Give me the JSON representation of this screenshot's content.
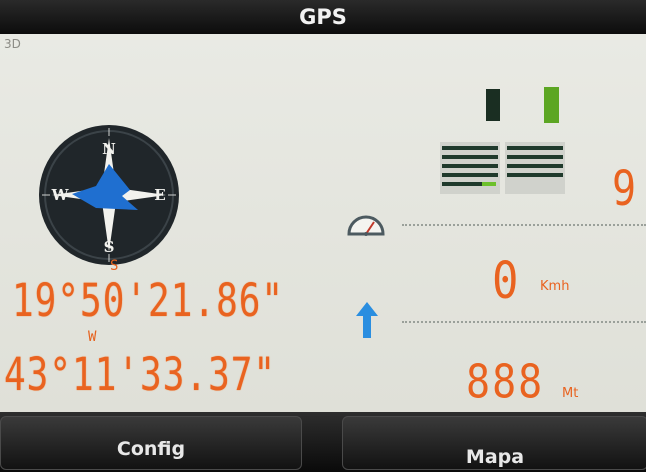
{
  "title": "GPS",
  "mode": "3D",
  "compass": {
    "n": "N",
    "s": "S",
    "e": "E",
    "w": "W"
  },
  "latitude": {
    "hemisphere": "S",
    "value": "19°50'21.86\""
  },
  "longitude": {
    "hemisphere": "W",
    "value": "43°11'33.37\""
  },
  "satellites": {
    "count": "9"
  },
  "speed": {
    "value": "0",
    "unit": "Kmh"
  },
  "altitude": {
    "value": "888",
    "unit": "Mt"
  },
  "buttons": {
    "config": "Config",
    "mapa": "Mapa"
  },
  "colors": {
    "accent": "#e96320",
    "signal_green": "#5ca623",
    "compass_blue": "#1f6fd0"
  }
}
